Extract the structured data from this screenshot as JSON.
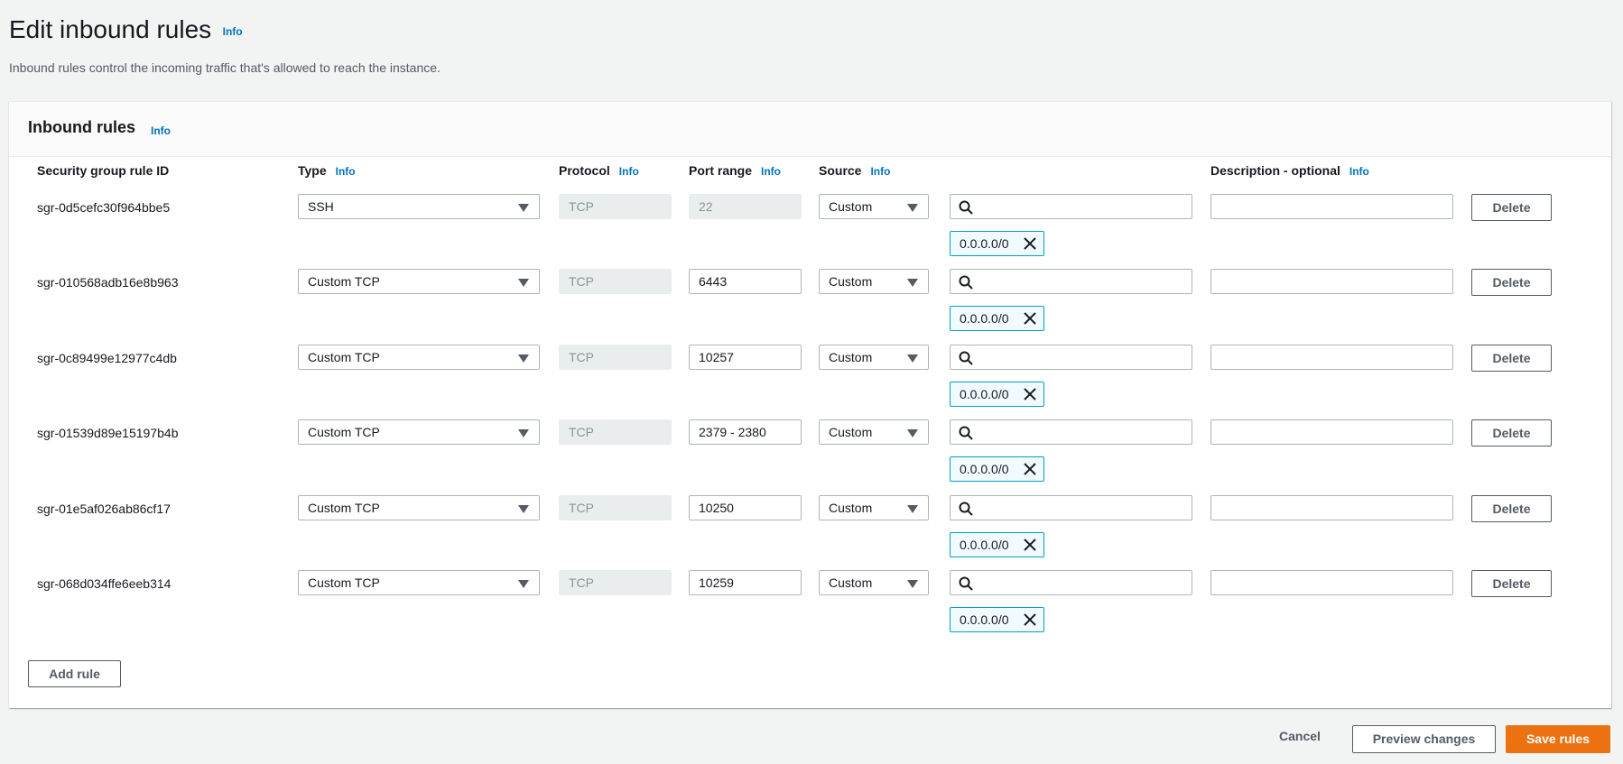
{
  "page": {
    "title": "Edit inbound rules",
    "info": "Info",
    "description": "Inbound rules control the incoming traffic that's allowed to reach the instance."
  },
  "panel": {
    "title": "Inbound rules",
    "info": "Info",
    "columns": {
      "rule_id": "Security group rule ID",
      "type": "Type",
      "protocol": "Protocol",
      "port_range": "Port range",
      "source": "Source",
      "description": "Description - optional",
      "info": "Info"
    },
    "rules": [
      {
        "id": "sgr-0d5cefc30f964bbe5",
        "type": "SSH",
        "protocol": "TCP",
        "port": "22",
        "port_disabled": true,
        "source": "Custom",
        "cidr": "0.0.0.0/0",
        "description": "",
        "delete": "Delete"
      },
      {
        "id": "sgr-010568adb16e8b963",
        "type": "Custom TCP",
        "protocol": "TCP",
        "port": "6443",
        "port_disabled": false,
        "source": "Custom",
        "cidr": "0.0.0.0/0",
        "description": "",
        "delete": "Delete"
      },
      {
        "id": "sgr-0c89499e12977c4db",
        "type": "Custom TCP",
        "protocol": "TCP",
        "port": "10257",
        "port_disabled": false,
        "source": "Custom",
        "cidr": "0.0.0.0/0",
        "description": "",
        "delete": "Delete"
      },
      {
        "id": "sgr-01539d89e15197b4b",
        "type": "Custom TCP",
        "protocol": "TCP",
        "port": "2379 - 2380",
        "port_disabled": false,
        "source": "Custom",
        "cidr": "0.0.0.0/0",
        "description": "",
        "delete": "Delete"
      },
      {
        "id": "sgr-01e5af026ab86cf17",
        "type": "Custom TCP",
        "protocol": "TCP",
        "port": "10250",
        "port_disabled": false,
        "source": "Custom",
        "cidr": "0.0.0.0/0",
        "description": "",
        "delete": "Delete"
      },
      {
        "id": "sgr-068d034ffe6eeb314",
        "type": "Custom TCP",
        "protocol": "TCP",
        "port": "10259",
        "port_disabled": false,
        "source": "Custom",
        "cidr": "0.0.0.0/0",
        "description": "",
        "delete": "Delete"
      }
    ],
    "add_rule": "Add rule"
  },
  "footer": {
    "cancel": "Cancel",
    "preview": "Preview changes",
    "save": "Save rules"
  },
  "colors": {
    "link": "#0073bb",
    "primary": "#ec7211",
    "token_border": "#00a1c9",
    "token_bg": "#f1faff"
  },
  "icons": [
    "search-icon",
    "close-icon",
    "caret-down-icon"
  ]
}
